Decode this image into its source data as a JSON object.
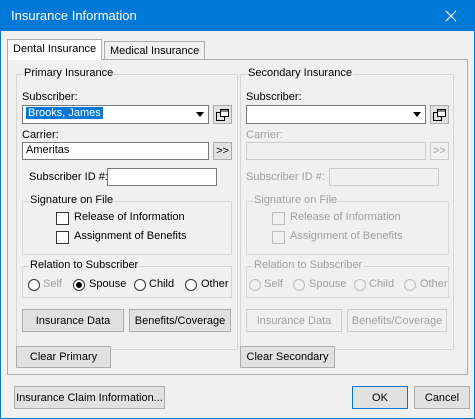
{
  "window": {
    "title": "Insurance Information"
  },
  "tabs": [
    {
      "label": "Dental Insurance"
    },
    {
      "label": "Medical Insurance"
    }
  ],
  "primary": {
    "group_title": "Primary Insurance",
    "subscriber_label": "Subscriber:",
    "subscriber_value": "Brooks, James",
    "carrier_label": "Carrier:",
    "carrier_value": "Ameritas",
    "browse_label": ">>",
    "subscriber_id_label": "Subscriber ID #:",
    "subscriber_id_value": "",
    "signature": {
      "title": "Signature on File",
      "release_label": "Release of Information",
      "release_checked": false,
      "assignment_label": "Assignment of Benefits",
      "assignment_checked": false
    },
    "relation": {
      "title": "Relation to Subscriber",
      "options": [
        "Self",
        "Spouse",
        "Child",
        "Other"
      ],
      "selected": "Spouse"
    },
    "insurance_data_label": "Insurance Data",
    "benefits_label": "Benefits/Coverage"
  },
  "secondary": {
    "group_title": "Secondary Insurance",
    "subscriber_label": "Subscriber:",
    "subscriber_value": "",
    "carrier_label": "Carrier:",
    "carrier_value": "",
    "browse_label": ">>",
    "subscriber_id_label": "Subscriber ID #:",
    "subscriber_id_value": "",
    "signature": {
      "title": "Signature on File",
      "release_label": "Release of Information",
      "release_checked": false,
      "assignment_label": "Assignment of Benefits",
      "assignment_checked": false
    },
    "relation": {
      "title": "Relation to Subscriber",
      "options": [
        "Self",
        "Spouse",
        "Child",
        "Other"
      ],
      "selected": ""
    },
    "insurance_data_label": "Insurance Data",
    "benefits_label": "Benefits/Coverage"
  },
  "buttons": {
    "clear_primary": "Clear Primary",
    "clear_secondary": "Clear Secondary",
    "claim_info": "Insurance Claim Information...",
    "ok": "OK",
    "cancel": "Cancel"
  },
  "colors": {
    "title_bar": "#0078d7",
    "selection": "#0078d7",
    "disabled_text": "#a0a0a0"
  }
}
